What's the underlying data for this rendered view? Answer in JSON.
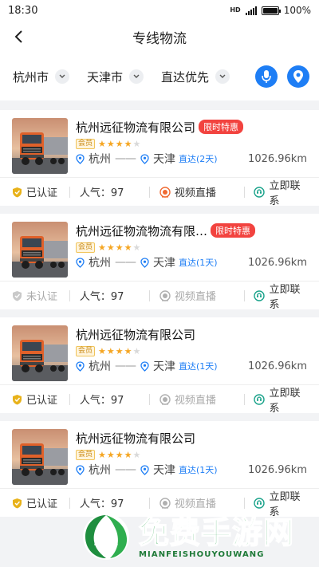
{
  "status_bar": {
    "time": "18:30",
    "battery": "100%",
    "battery_level": 1.0
  },
  "nav": {
    "title": "专线物流"
  },
  "filters": [
    {
      "label": "杭州市"
    },
    {
      "label": "天津市"
    },
    {
      "label": "直达优先"
    }
  ],
  "icons": {
    "mic": "microphone-icon",
    "location": "location-pin-icon",
    "chevron": "chevron-down-icon",
    "back": "back-arrow-icon"
  },
  "cards": [
    {
      "company": "杭州远征物流有限公司",
      "promo": "限时特惠",
      "member": "会员",
      "rating": 4,
      "from": "杭州",
      "dash": "——",
      "to": "天津",
      "direct": "直达(2天)",
      "distance": "1026.96km",
      "cert": "已认证",
      "certified": true,
      "popularity": "人气：97",
      "live": "视频直播",
      "live_active": true,
      "contact": "立即联系"
    },
    {
      "company": "杭州远征物流物流有限…",
      "promo": "限时特惠",
      "member": "会员",
      "rating": 4,
      "from": "杭州",
      "dash": "——",
      "to": "天津",
      "direct": "直达(1天)",
      "distance": "1026.96km",
      "cert": "未认证",
      "certified": false,
      "popularity": "人气：97",
      "live": "视频直播",
      "live_active": false,
      "contact": "立即联系"
    },
    {
      "company": "杭州远征物流有限公司",
      "promo": "",
      "member": "会员",
      "rating": 4,
      "from": "杭州",
      "dash": "——",
      "to": "天津",
      "direct": "直达(1天)",
      "distance": "1026.96km",
      "cert": "已认证",
      "certified": true,
      "popularity": "人气：97",
      "live": "视频直播",
      "live_active": false,
      "contact": "立即联系"
    },
    {
      "company": "杭州远征物流有限公司",
      "promo": "",
      "member": "会员",
      "rating": 4,
      "from": "杭州",
      "dash": "——",
      "to": "天津",
      "direct": "直达(1天)",
      "distance": "1026.96km",
      "cert": "已认证",
      "certified": true,
      "popularity": "人气：97",
      "live": "视频直播",
      "live_active": false,
      "contact": "立即联系"
    }
  ],
  "watermark": {
    "title": "免费手游网",
    "subtitle": "MIANFEISHOUYOUWANG"
  },
  "colors": {
    "accent": "#1e7ef5",
    "promo": "#f2433f",
    "star": "#f5a623",
    "certified": "#e8b21a",
    "contact": "#19a28a",
    "live": "#f06a32"
  }
}
